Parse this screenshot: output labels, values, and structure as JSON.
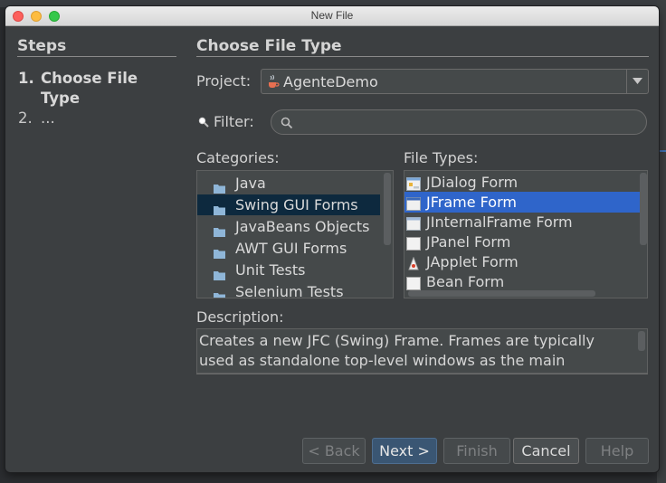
{
  "window": {
    "title": "New File"
  },
  "steps": {
    "heading": "Steps",
    "items": [
      {
        "num": "1.",
        "label": "Choose File Type"
      },
      {
        "num": "2.",
        "label": "..."
      }
    ]
  },
  "main": {
    "heading": "Choose File Type",
    "project_label": "Project:",
    "project_value": "AgenteDemo",
    "filter_label": "Filter:",
    "filter_value": "",
    "categories_label": "Categories:",
    "categories": [
      "Java",
      "Swing GUI Forms",
      "JavaBeans Objects",
      "AWT GUI Forms",
      "Unit Tests",
      "Selenium Tests"
    ],
    "selected_category": "Swing GUI Forms",
    "file_types_label": "File Types:",
    "file_types": [
      "JDialog Form",
      "JFrame Form",
      "JInternalFrame Form",
      "JPanel Form",
      "JApplet Form",
      "Bean Form"
    ],
    "selected_file_type": "JFrame Form",
    "description_label": "Description:",
    "description_lines": [
      "Creates a new JFC (Swing) Frame. Frames are typically",
      "used as standalone top-level windows as the main"
    ]
  },
  "buttons": {
    "back": "< Back",
    "next": "Next >",
    "finish": "Finish",
    "cancel": "Cancel",
    "help": "Help"
  },
  "colors": {
    "window_bg": "#3c3f41",
    "selection_file_type": "#2f65ca",
    "selection_category": "#0d293e"
  }
}
